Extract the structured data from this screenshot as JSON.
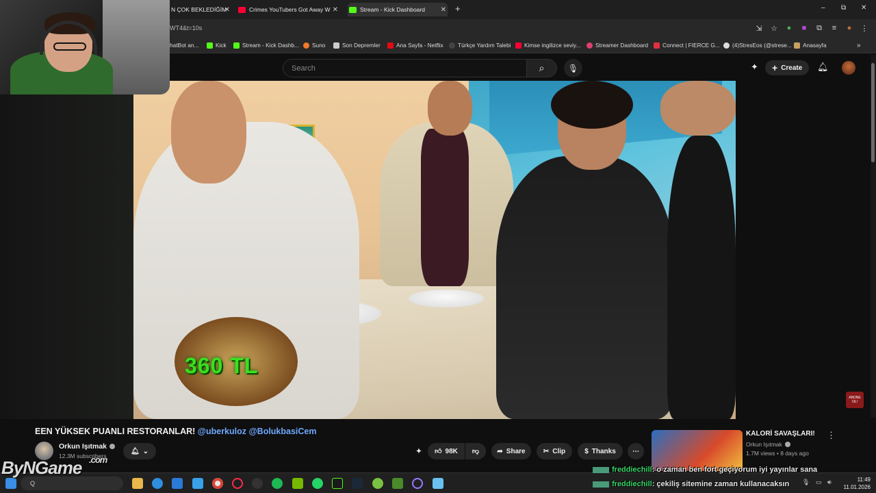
{
  "browser": {
    "tabs": [
      {
        "title": "N ÇOK BEKLEDİĞİM",
        "favicon_color": "#ff0033"
      },
      {
        "title": "Crimes YouTubers Got Away W",
        "favicon_color": "#ff0033"
      },
      {
        "title": "Stream - Kick Dashboard",
        "favicon_color": "#53fc18"
      }
    ],
    "new_tab": "+",
    "window_controls": [
      "–",
      "⧉",
      "✕"
    ],
    "url": "WT4&t=10s",
    "bookmarks": [
      {
        "label": "hatBot an...",
        "color": "#888888"
      },
      {
        "label": "Kick",
        "color": "#53fc18"
      },
      {
        "label": "Stream - Kick Dashb...",
        "color": "#53fc18"
      },
      {
        "label": "Suno",
        "color": "#f07a2a"
      },
      {
        "label": "Son Depremler",
        "color": "#cccccc"
      },
      {
        "label": "Ana Sayfa - Netflix",
        "color": "#e50914"
      },
      {
        "label": "Türkçe Yardım Talebi",
        "color": "#444444"
      },
      {
        "label": "Kimse ingilizce seviy...",
        "color": "#ff0033"
      },
      {
        "label": "Streamer Dashboard",
        "color": "#e04070"
      },
      {
        "label": "Connect | FIERCE G...",
        "color": "#e03040"
      },
      {
        "label": "(4)StresEos (@strese...",
        "color": "#dddddd"
      },
      {
        "label": "Anasayfa",
        "color": "#c8a060"
      }
    ]
  },
  "youtube": {
    "search_placeholder": "Search",
    "create_label": "Create",
    "video_title_main": "EEN YÜKSEK PUANLI RESTORANLAR!",
    "video_title_tags": "@uberkuloz @BolukbasiCem",
    "overlay_price": "360 TL",
    "subscribe_badge": "ABONE OL!",
    "channel": {
      "name": "Orkun Işıtmak",
      "subscribers": "12.3M subscribers"
    },
    "actions": {
      "likes": "98K",
      "share": "Share",
      "clip": "Clip",
      "thanks": "Thanks"
    },
    "recommended": {
      "title": "KALORİ SAVAŞLARI!",
      "channel": "Orkun Işıtmak",
      "meta": "1.7M views • 8 days ago"
    },
    "accent_color": "#6ea8fe"
  },
  "chat": [
    {
      "user": "freddiechill",
      "message": ": o zaman ben fort geçiyorum iyi yayınlar sana"
    },
    {
      "user": "freddiechill",
      "message": ": çekiliş sitemine zaman kullanacaksın"
    }
  ],
  "taskbar": {
    "search_label": "Q",
    "time": "11:49",
    "date": "11.01.2026"
  },
  "watermark": {
    "text": "ByNGame",
    "suffix": ".com"
  }
}
